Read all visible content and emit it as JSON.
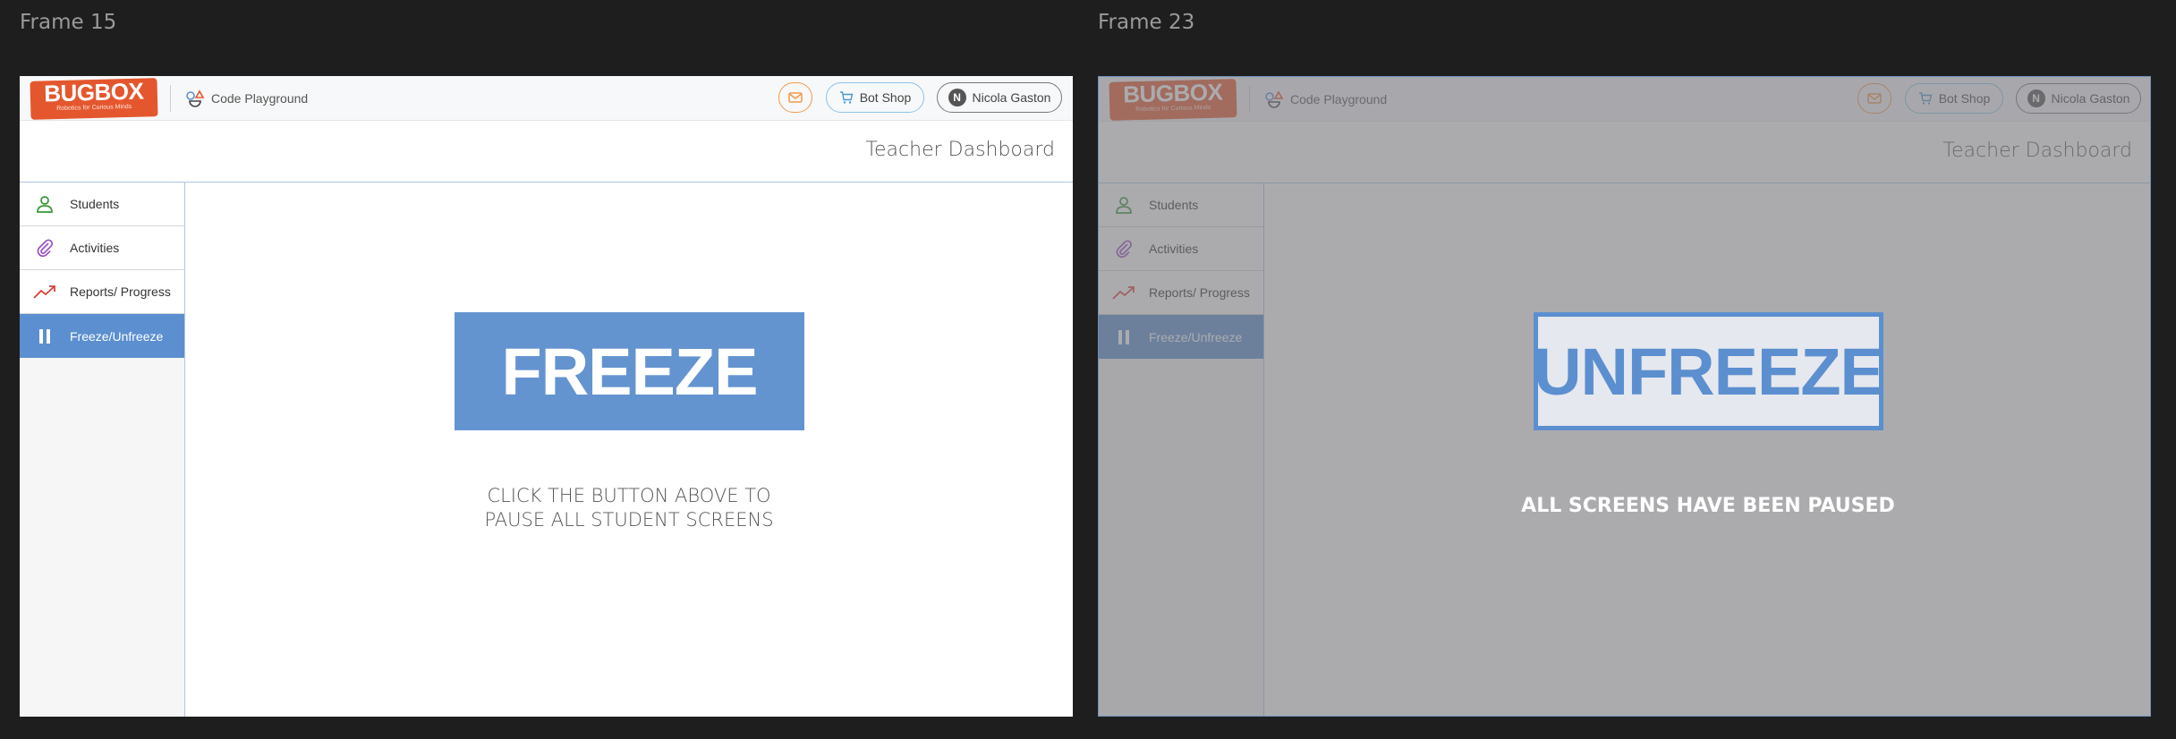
{
  "frames": [
    {
      "label": "Frame 15",
      "brand": {
        "name": "BUGBOX",
        "tagline": "Robotics for Curious Minds"
      },
      "nav_link": "Code Playground",
      "header_buttons": {
        "shop": "Bot Shop",
        "user_initial": "N",
        "user_name": "Nicola Gaston"
      },
      "page_title": "Teacher Dashboard",
      "sidebar": [
        {
          "label": "Students",
          "icon": "person-icon"
        },
        {
          "label": "Activities",
          "icon": "paperclip-icon"
        },
        {
          "label": "Reports/ Progress",
          "icon": "trend-up-icon"
        },
        {
          "label": "Freeze/Unfreeze",
          "icon": "pause-icon",
          "active": true
        }
      ],
      "main_button": "FREEZE",
      "hint_line1": "CLICK THE BUTTON ABOVE TO",
      "hint_line2": "PAUSE ALL STUDENT SCREENS"
    },
    {
      "label": "Frame 23",
      "brand": {
        "name": "BUGBOX",
        "tagline": "Robotics for Curious Minds"
      },
      "nav_link": "Code Playground",
      "header_buttons": {
        "shop": "Bot Shop",
        "user_initial": "N",
        "user_name": "Nicola Gaston"
      },
      "page_title": "Teacher Dashboard",
      "sidebar": [
        {
          "label": "Students",
          "icon": "person-icon"
        },
        {
          "label": "Activities",
          "icon": "paperclip-icon"
        },
        {
          "label": "Reports/ Progress",
          "icon": "trend-up-icon"
        },
        {
          "label": "Freeze/Unfreeze",
          "icon": "pause-icon",
          "active": true
        }
      ],
      "main_button": "UNFREEZE",
      "status": "ALL SCREENS HAVE BEEN PAUSED",
      "overlay": "dimmed"
    }
  ],
  "colors": {
    "brand": "#e4572e",
    "accent": "#5b8fcf",
    "background": "#1e1e1e"
  }
}
